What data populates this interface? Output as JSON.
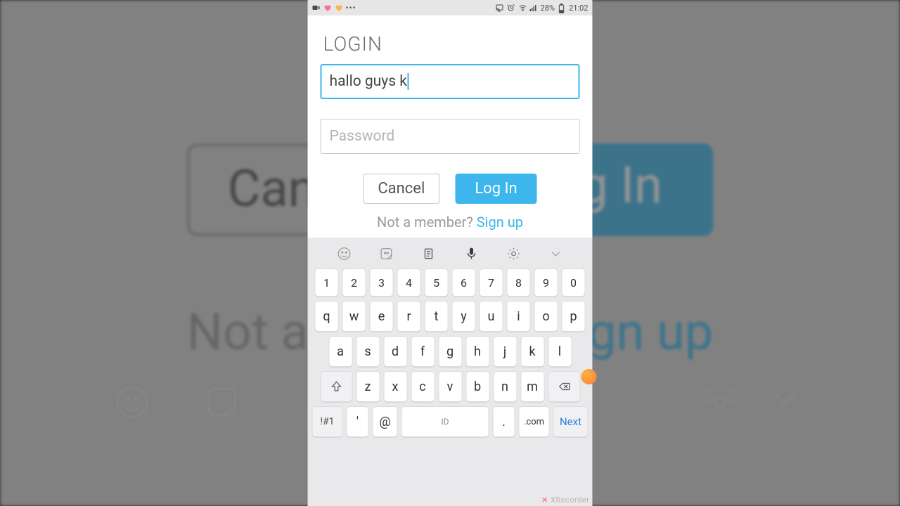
{
  "statusbar": {
    "time": "21:02",
    "battery": "28%"
  },
  "login": {
    "title": "LOGIN",
    "username_value": "hallo guys k",
    "password_placeholder": "Password",
    "cancel_label": "Cancel",
    "login_label": "Log In",
    "not_member_text": "Not a member? ",
    "signup_label": "Sign up"
  },
  "keyboard": {
    "row_num": [
      "1",
      "2",
      "3",
      "4",
      "5",
      "6",
      "7",
      "8",
      "9",
      "0"
    ],
    "row_q": [
      "q",
      "w",
      "e",
      "r",
      "t",
      "y",
      "u",
      "i",
      "o",
      "p"
    ],
    "row_a": [
      "a",
      "s",
      "d",
      "f",
      "g",
      "h",
      "j",
      "k",
      "l"
    ],
    "row_z": [
      "z",
      "x",
      "c",
      "v",
      "b",
      "n",
      "m"
    ],
    "sym_label": "!#1",
    "apos": "'",
    "at": "@",
    "space_label": "ID",
    "dot": ".",
    "com": ".com",
    "next_label": "Next"
  },
  "watermark": "XRecorder",
  "bg": {
    "cancel": "Cancel",
    "login": "Log In",
    "not": "Not a member? ",
    "signup": "Sign up"
  }
}
